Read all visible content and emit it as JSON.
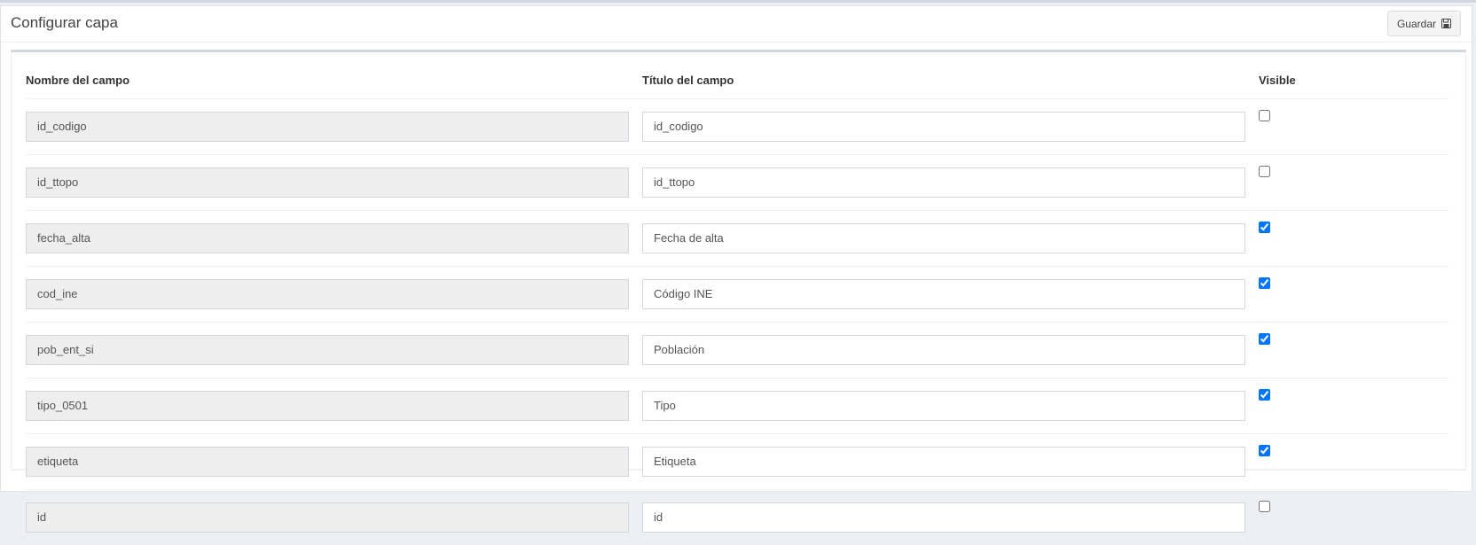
{
  "header": {
    "title": "Configurar capa",
    "save_label": "Guardar"
  },
  "table": {
    "columns": [
      "Nombre del campo",
      "Título del campo",
      "Visible"
    ],
    "rows": [
      {
        "name": "id_codigo",
        "title": "id_codigo",
        "visible": false
      },
      {
        "name": "id_ttopo",
        "title": "id_ttopo",
        "visible": false
      },
      {
        "name": "fecha_alta",
        "title": "Fecha de alta",
        "visible": true
      },
      {
        "name": "cod_ine",
        "title": "Código INE",
        "visible": true
      },
      {
        "name": "pob_ent_si",
        "title": "Población",
        "visible": true
      },
      {
        "name": "tipo_0501",
        "title": "Tipo",
        "visible": true
      },
      {
        "name": "etiqueta",
        "title": "Etiqueta",
        "visible": true
      },
      {
        "name": "id",
        "title": "id",
        "visible": false
      }
    ]
  },
  "colors": {
    "accent_border": "#d2d6de",
    "readonly_bg": "#eeeeee"
  },
  "icons": {
    "save": "floppy-disk-icon"
  }
}
